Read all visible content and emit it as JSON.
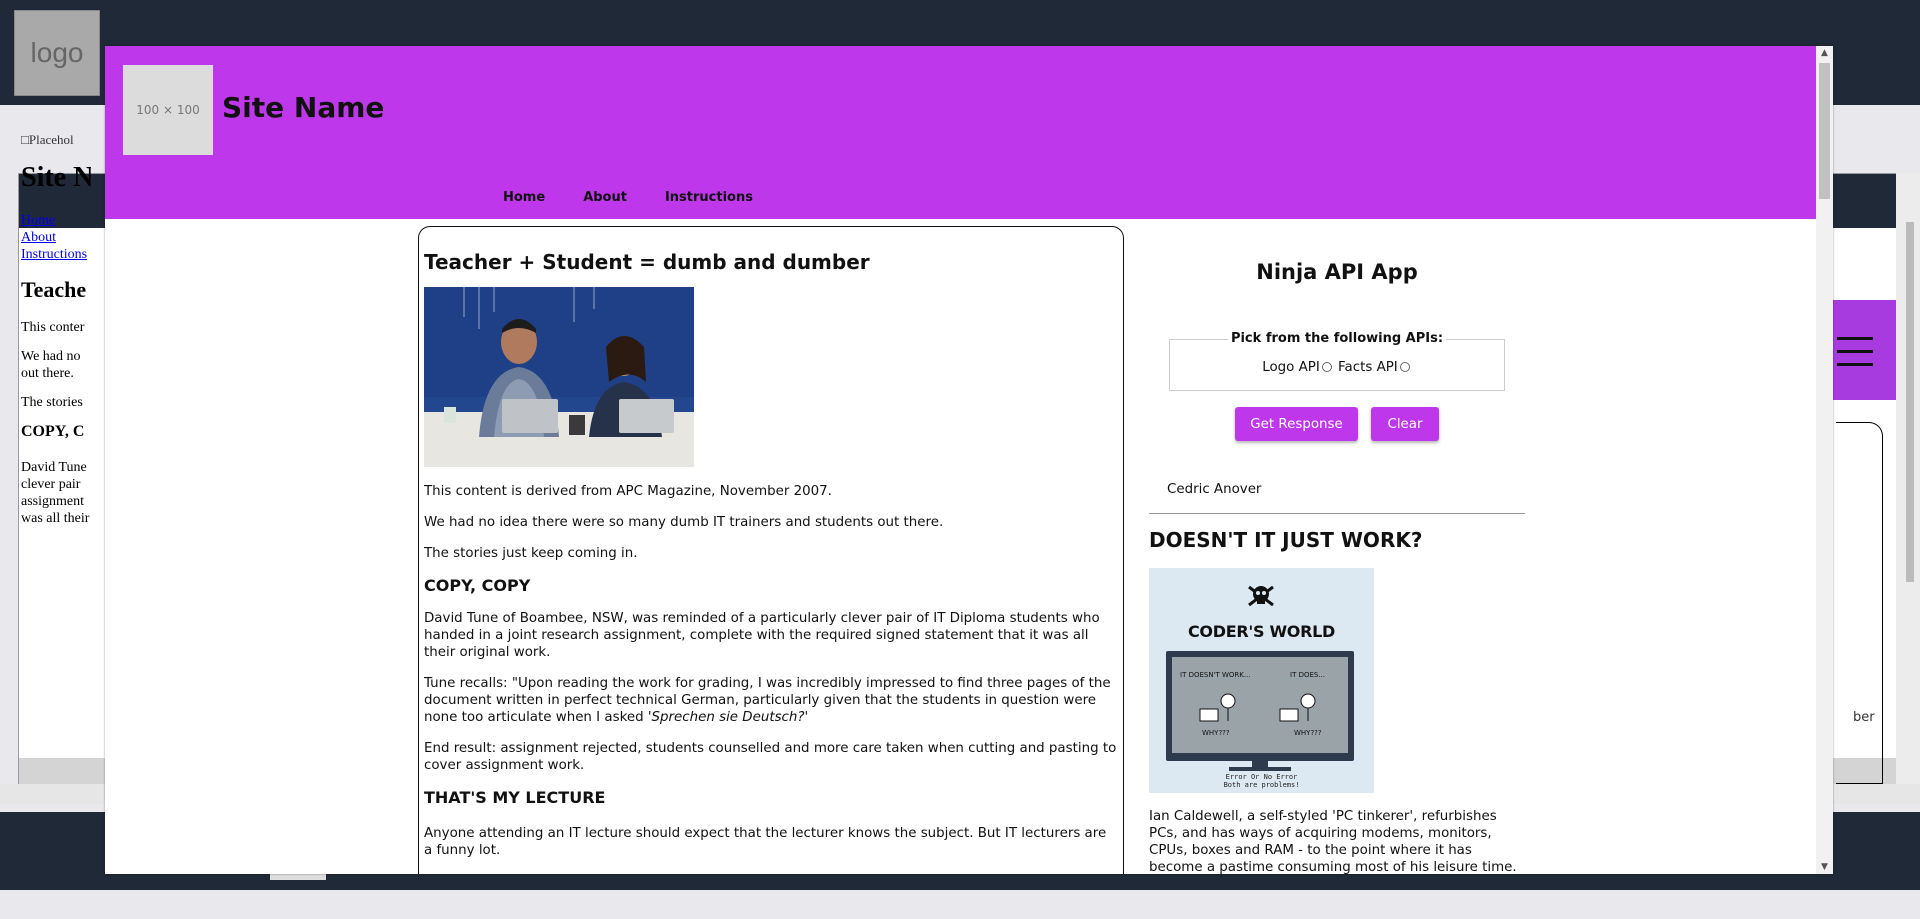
{
  "background_page": {
    "logo_text": "logo",
    "placeholder_img": "Placehol",
    "site_name": "Site N",
    "nav": [
      "Home",
      "About",
      "Instructions"
    ],
    "article_title": "Teache",
    "p1": "This conter",
    "p2": "We had no out there.",
    "p3": "The stories",
    "h_copy": "COPY, C",
    "p4": "David Tune clever pair assignment was all their",
    "partial_text": "ber"
  },
  "header": {
    "logo_placeholder": "100 × 100",
    "site_name": "Site Name",
    "nav": [
      {
        "label": "Home"
      },
      {
        "label": "About"
      },
      {
        "label": "Instructions"
      }
    ]
  },
  "article": {
    "title": "Teacher + Student = dumb and dumber",
    "p_source": "This content is derived from APC Magazine, November 2007.",
    "p_noidea": "We had no idea there were so many dumb IT trainers and students out there.",
    "p_stories": "The stories just keep coming in.",
    "h_copy": "COPY, COPY",
    "p_david": "David Tune of Boambee, NSW, was reminded of a particularly clever pair of IT Diploma students who handed in a joint research assignment, complete with the required signed statement that it was all their original work.",
    "p_tune_a": "Tune recalls: \"Upon reading the work for grading, I was incredibly impressed to find three pages of the document written in perfect technical German, particularly given that the students in question were none too articulate when I asked ",
    "p_tune_em": "'Sprechen sie Deutsch?'",
    "p_result": "End result: assignment rejected, students counselled and more care taken when cutting and pasting to cover assignment work.",
    "h_lecture": "THAT'S MY LECTURE",
    "p_lecture": "Anyone attending an IT lecture should expect that the lecturer knows the subject. But IT lecturers are a funny lot."
  },
  "sidebar": {
    "app_title": "Ninja API App",
    "fieldset_legend": "Pick from the following APIs:",
    "options": [
      {
        "label": "Logo API"
      },
      {
        "label": "Facts API"
      }
    ],
    "get_button": "Get Response",
    "clear_button": "Clear",
    "author": "Cedric Anover",
    "heading": "DOESN'T IT JUST WORK?",
    "image": {
      "title": "CODER'S WORLD",
      "left_caption": "IT DOESN'T WORK...",
      "right_caption": "IT DOES...",
      "left_why": "WHY???",
      "right_why": "WHY???",
      "footer_line1": "Error Or No Error",
      "footer_line2": "Both are problems!"
    },
    "text": "Ian Caldewell, a self-styled 'PC tinkerer', refurbishes PCs, and has ways of acquiring modems, monitors, CPUs, boxes and RAM - to the point where it has become a pastime consuming most of his leisure time. He now has streams of"
  },
  "colors": {
    "header_purple": "#bf37eb",
    "dark_bar": "#1f2937"
  }
}
